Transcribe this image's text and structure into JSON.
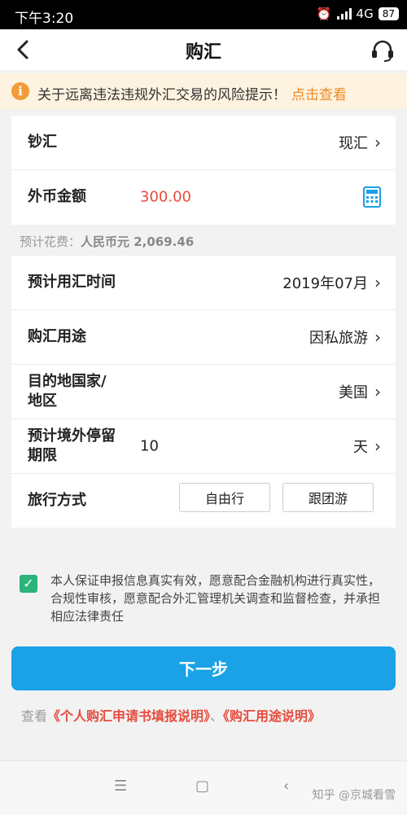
{
  "status": {
    "time": "下午3:20",
    "network": "4G",
    "battery": "87"
  },
  "header": {
    "title": "购汇",
    "back_icon": "chevron-left-icon",
    "cs_icon": "headset-icon"
  },
  "notice": {
    "icon": "info-icon",
    "text": "关于远离违法违规外汇交易的风险提示！",
    "link": "点击查看"
  },
  "form": {
    "cash_label": "钞汇",
    "cash_value": "现汇",
    "amount_label": "外币金额",
    "amount_value": "300.00",
    "estimate_prefix": "预计花费：",
    "estimate_value": "人民币元  2,069.46",
    "time_label": "预计用汇时间",
    "time_value": "2019年07月",
    "purpose_label": "购汇用途",
    "purpose_value": "因私旅游",
    "dest_label_1": "目的地国家/",
    "dest_label_2": "地区",
    "dest_value": "美国",
    "stay_label_1": "预计境外停留",
    "stay_label_2": "期限",
    "stay_number": "10",
    "stay_unit": "天",
    "travel_label": "旅行方式",
    "travel_opt1": "自由行",
    "travel_opt2": "跟团游"
  },
  "agreement": "本人保证申报信息真实有效，愿意配合金融机构进行真实性，合规性审核，愿意配合外汇管理机关调查和监督检查，并承担相应法律责任",
  "next_button": "下一步",
  "links": {
    "prefix": "查看",
    "link1": "《个人购汇申请书填报说明》",
    "sep": "、",
    "link2": "《购汇用途说明》"
  },
  "watermark": "知乎 @京城看雪",
  "colors": {
    "primary": "#1aa1e6",
    "amount": "#e74b3c",
    "warning": "#f08a24",
    "check": "#2bb37a"
  }
}
